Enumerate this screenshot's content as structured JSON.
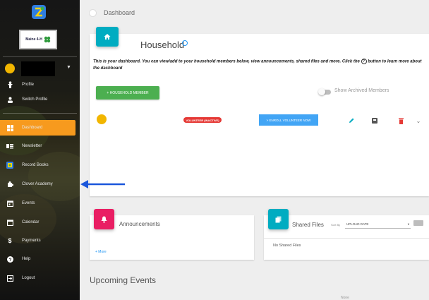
{
  "sidebar": {
    "logo_text": "Maine 4-H",
    "user_name": "",
    "items": [
      {
        "label": "Profile",
        "icon": "person-icon"
      },
      {
        "label": "Switch Profile",
        "icon": "switch-user-icon"
      },
      {
        "label": "Dashboard",
        "icon": "dashboard-icon",
        "active": true
      },
      {
        "label": "Newsletter",
        "icon": "newsletter-icon"
      },
      {
        "label": "Record Books",
        "icon": "record-books-icon"
      },
      {
        "label": "Clover Academy",
        "icon": "puzzle-icon"
      },
      {
        "label": "Events",
        "icon": "events-icon"
      },
      {
        "label": "Calendar",
        "icon": "calendar-icon"
      },
      {
        "label": "Payments",
        "icon": "dollar-icon"
      },
      {
        "label": "Help",
        "icon": "help-icon"
      },
      {
        "label": "Logout",
        "icon": "logout-icon"
      }
    ]
  },
  "header": {
    "breadcrumb": "Dashboard"
  },
  "household": {
    "title": "Household",
    "description_before": "This is your dashboard. You can view/add to your household members below, view announcements, shared files and more. Click the",
    "description_after": "button to learn more about the dashboard",
    "add_button": "+ HOUSEHOLD MEMBER",
    "archived_toggle_label": "Show Archived Members",
    "member": {
      "status_badge": "VOLUNTEER (INACTIVE)",
      "enroll_button": "> ENROLL VOLUNTEER NOW"
    }
  },
  "announcements": {
    "title": "Announcements",
    "more_link": "+ More"
  },
  "shared_files": {
    "title": "Shared Files",
    "sort_label": "Sort By",
    "sort_value": "UPLOAD DATE",
    "empty_text": "No Shared Files"
  },
  "upcoming_events": {
    "title": "Upcoming Events",
    "empty_text": "None"
  },
  "colors": {
    "active_nav": "#f79a1e",
    "household_badge": "#00acc1",
    "add_button": "#4caf50",
    "volunteer_badge": "#e53935",
    "enroll_button": "#42a5f5",
    "announcement_badge": "#e91e63",
    "annotation_arrow": "#1a56db"
  }
}
